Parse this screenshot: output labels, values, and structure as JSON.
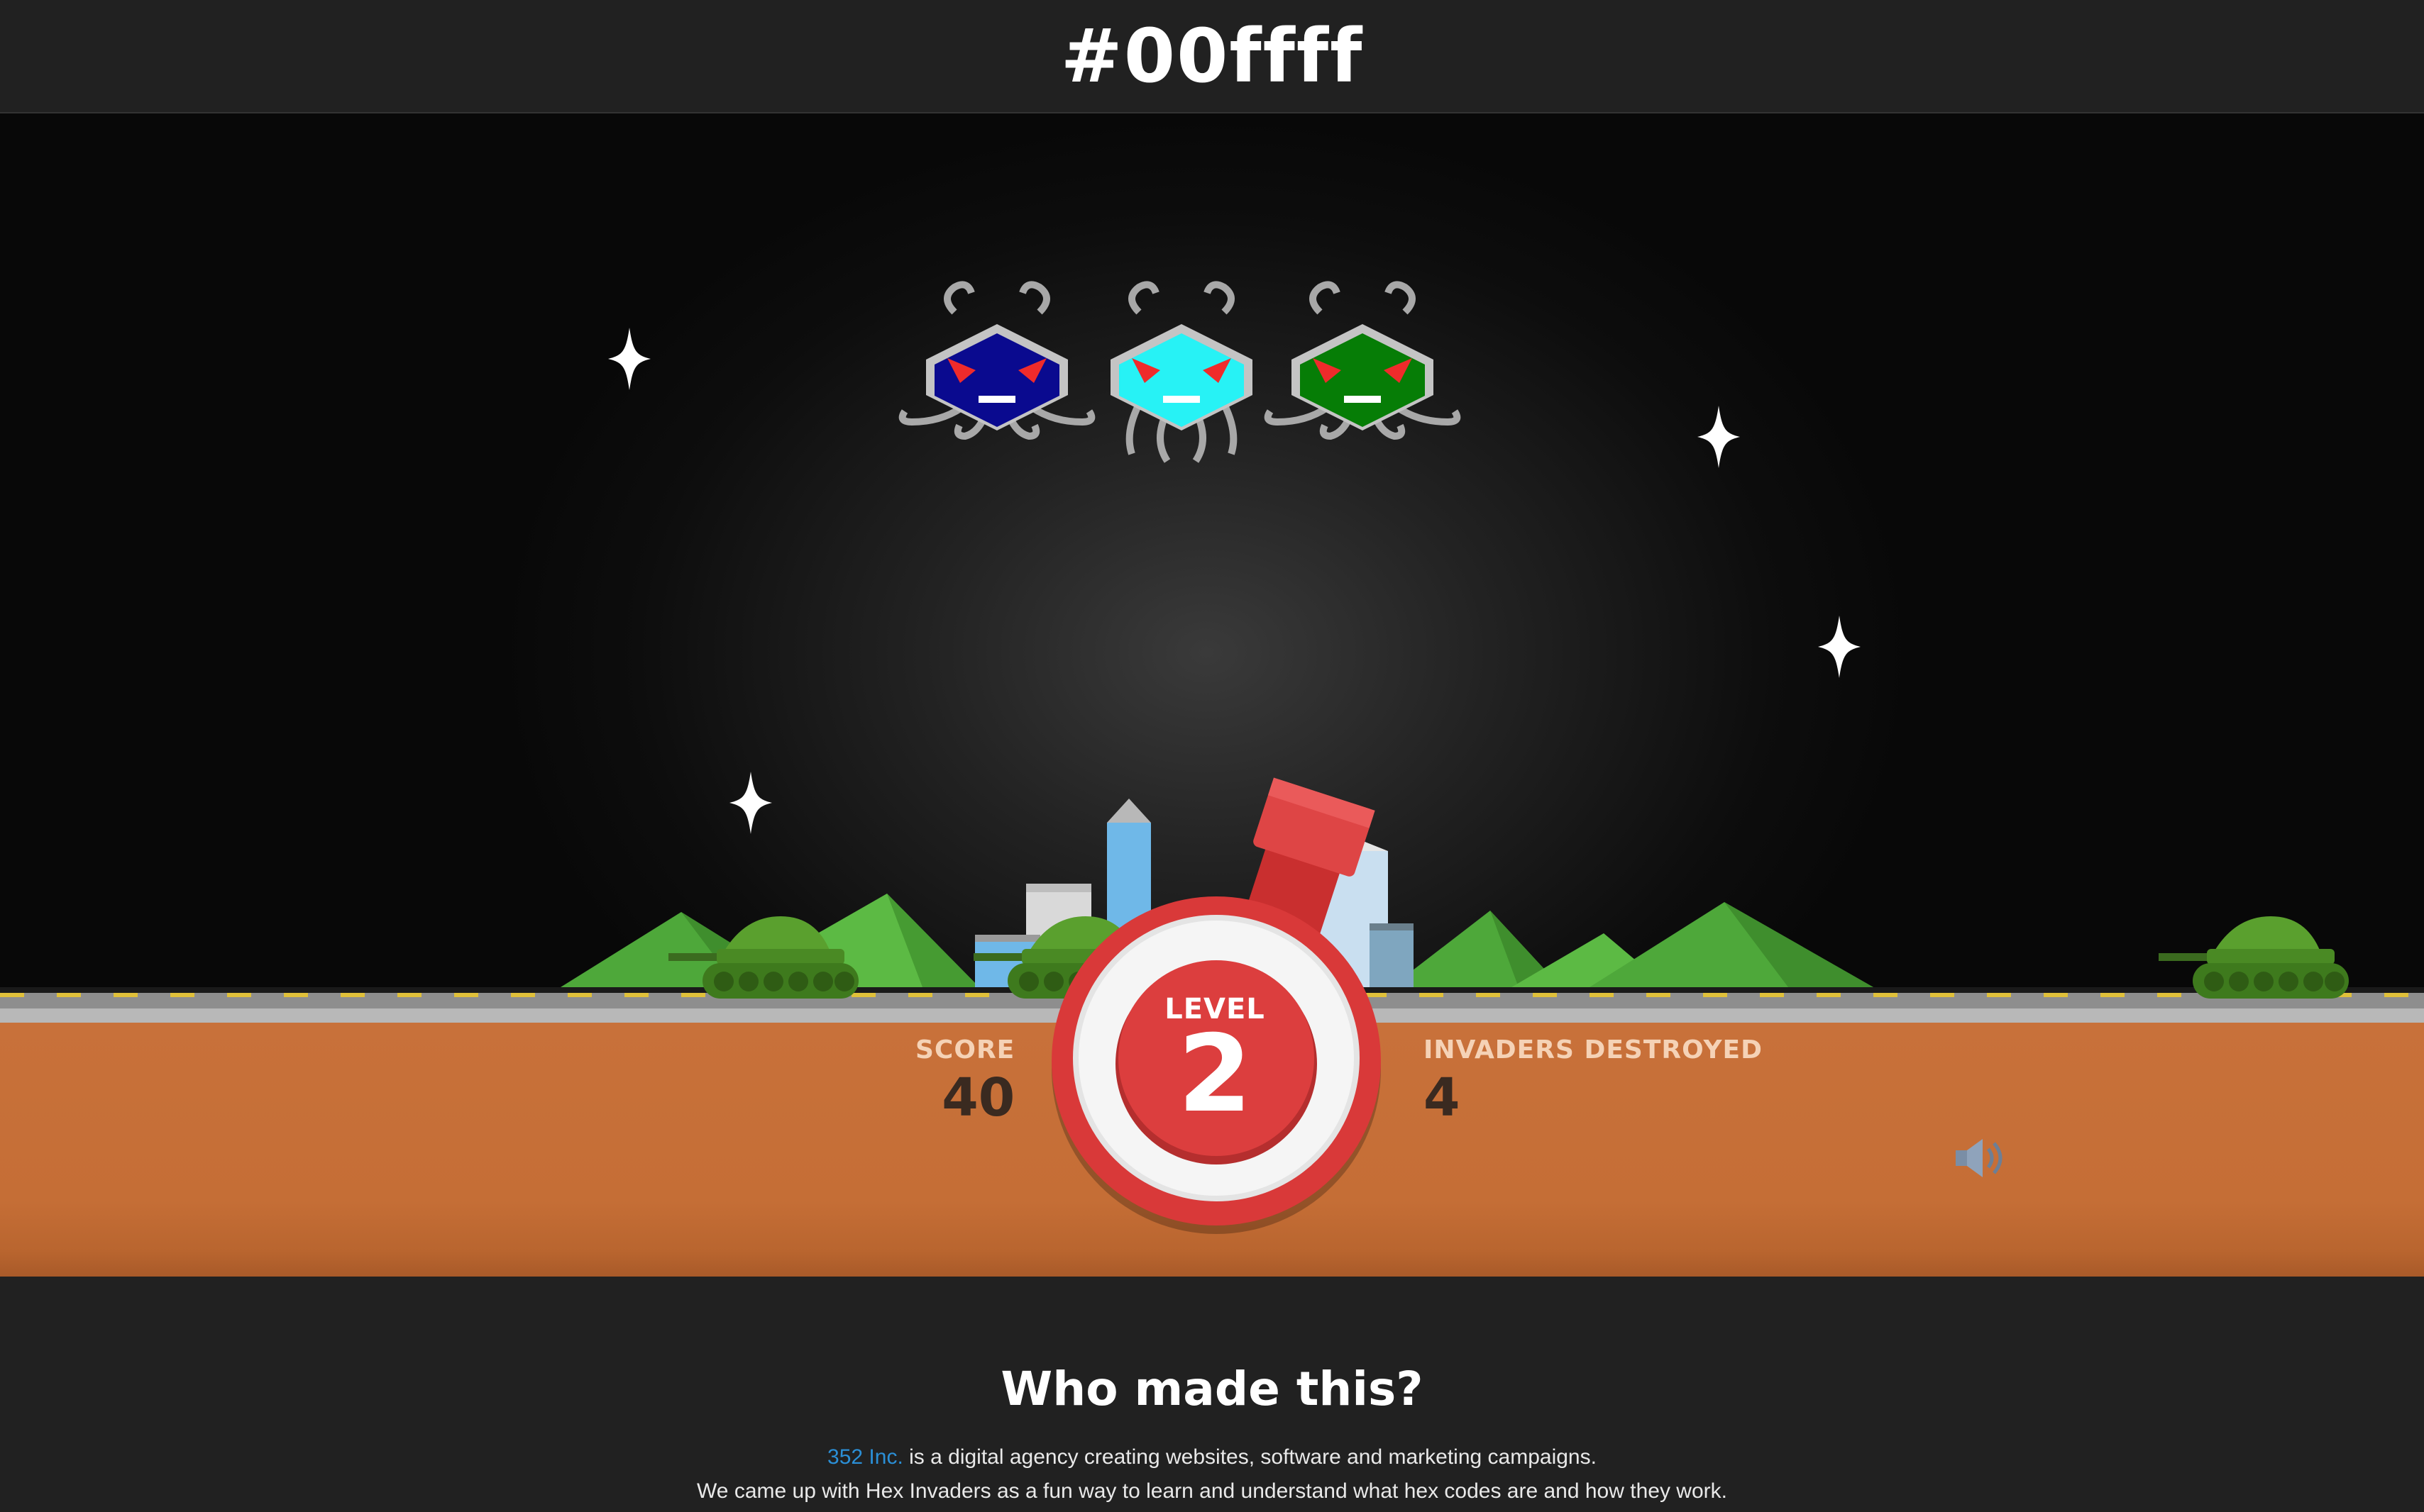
{
  "header": {
    "hex_code": "#00ffff"
  },
  "invaders": [
    {
      "name": "invader-1",
      "color": "#0a0a8f"
    },
    {
      "name": "invader-2",
      "color": "#27f2f5"
    },
    {
      "name": "invader-3",
      "color": "#067d06"
    }
  ],
  "hud": {
    "score_label": "SCORE",
    "score_value": "40",
    "level_label": "LEVEL",
    "level_value": "2",
    "destroyed_label": "INVADERS DESTROYED",
    "destroyed_value": "4"
  },
  "sound_icon": "speaker-icon",
  "footer": {
    "title": "Who made this?",
    "company_link": "352 Inc.",
    "line1_rest": " is a digital agency creating websites, software and marketing campaigns.",
    "line2": "We came up with Hex Invaders as a fun way to learn and understand what hex codes are and how they work."
  },
  "colors": {
    "ground": "#c8713a",
    "level_red": "#dc3e3e",
    "link": "#2b8fd6"
  }
}
